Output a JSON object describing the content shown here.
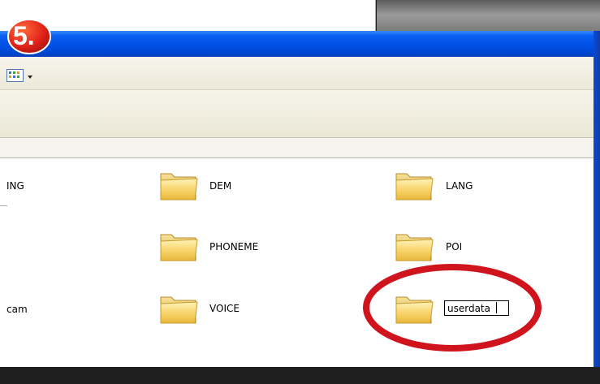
{
  "step": {
    "label": "5."
  },
  "folders": [
    {
      "name": "ING"
    },
    {
      "name": "DEM"
    },
    {
      "name": "LANG"
    },
    {
      "name": "PHONEME"
    },
    {
      "name": "POI"
    },
    {
      "name": "cam"
    },
    {
      "name": "VOICE"
    },
    {
      "name": "userdata",
      "renaming": true
    }
  ],
  "colors": {
    "titlebar": "#0050e6",
    "annotation": "#d0141d",
    "folder": "#f6c94a"
  },
  "icons": [
    "folder-icon",
    "views-icon",
    "chevron-down-icon"
  ]
}
